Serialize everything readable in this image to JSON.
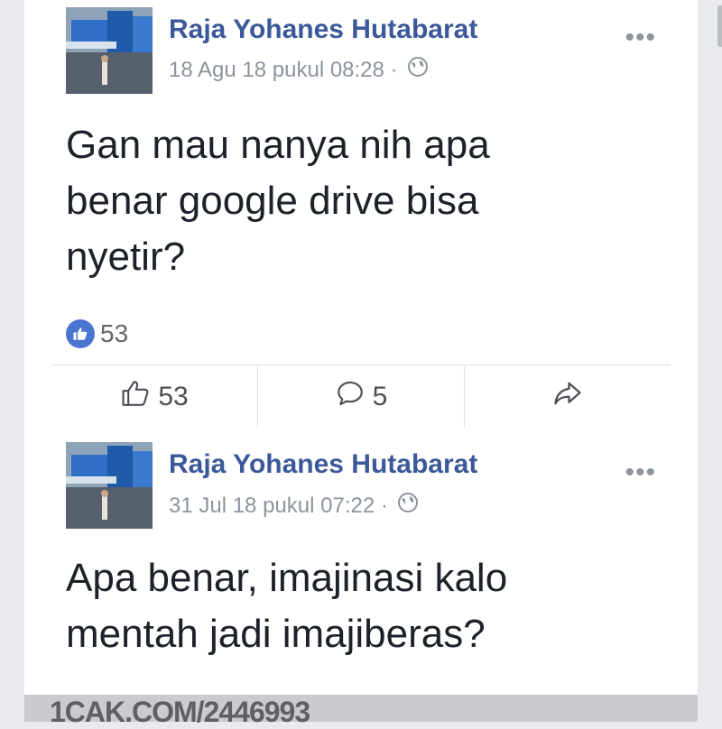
{
  "posts": [
    {
      "author": "Raja Yohanes Hutabarat",
      "meta": "18 Agu 18 pukul 08:28 ·",
      "text_lines": [
        "Gan mau nanya nih apa",
        "benar google drive bisa",
        "nyetir?"
      ],
      "reaction_count": "53",
      "like_count": "53",
      "comment_count": "5"
    },
    {
      "author": "Raja Yohanes Hutabarat",
      "meta": "31 Jul 18 pukul 07:22 ·",
      "text_lines": [
        "Apa benar, imajinasi kalo",
        "mentah jadi imajiberas?"
      ]
    }
  ],
  "more_glyph": "•••",
  "watermark": "1CAK.COM/2446993",
  "colors": {
    "author": "#3b5998",
    "like_bubble": "#4a76d0"
  },
  "icons": [
    "globe-icon",
    "thumbs-up-icon",
    "comment-icon",
    "share-icon",
    "more-options-icon"
  ]
}
